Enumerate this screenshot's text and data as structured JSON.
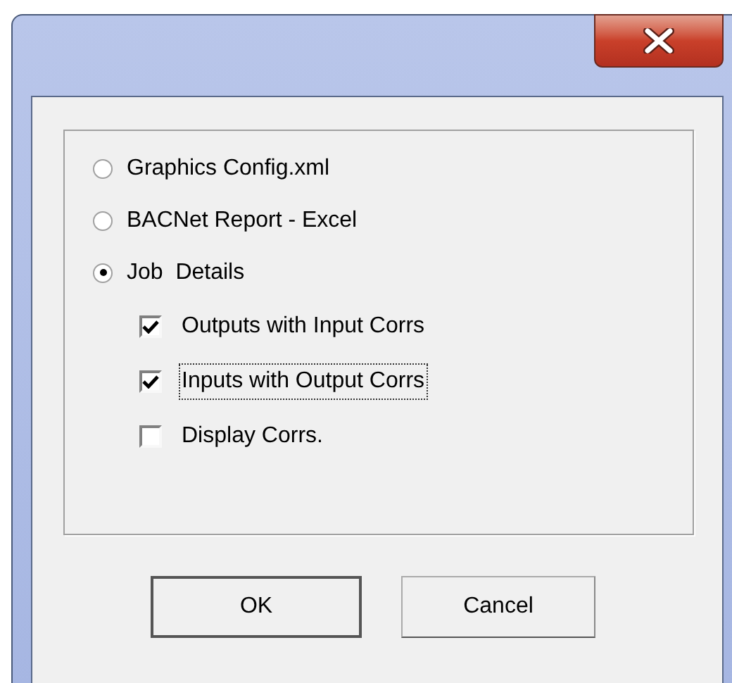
{
  "options": [
    {
      "label": "Graphics Config.xml",
      "selected": false
    },
    {
      "label": "BACNet Report - Excel",
      "selected": false
    },
    {
      "label": "Job  Details",
      "selected": true
    }
  ],
  "checkboxes": [
    {
      "label": "Outputs with Input Corrs",
      "checked": true,
      "focused": false
    },
    {
      "label": "Inputs with Output Corrs",
      "checked": true,
      "focused": true
    },
    {
      "label": "Display Corrs.",
      "checked": false,
      "focused": false
    }
  ],
  "buttons": [
    {
      "label": "OK",
      "default": true
    },
    {
      "label": "Cancel",
      "default": false
    }
  ]
}
